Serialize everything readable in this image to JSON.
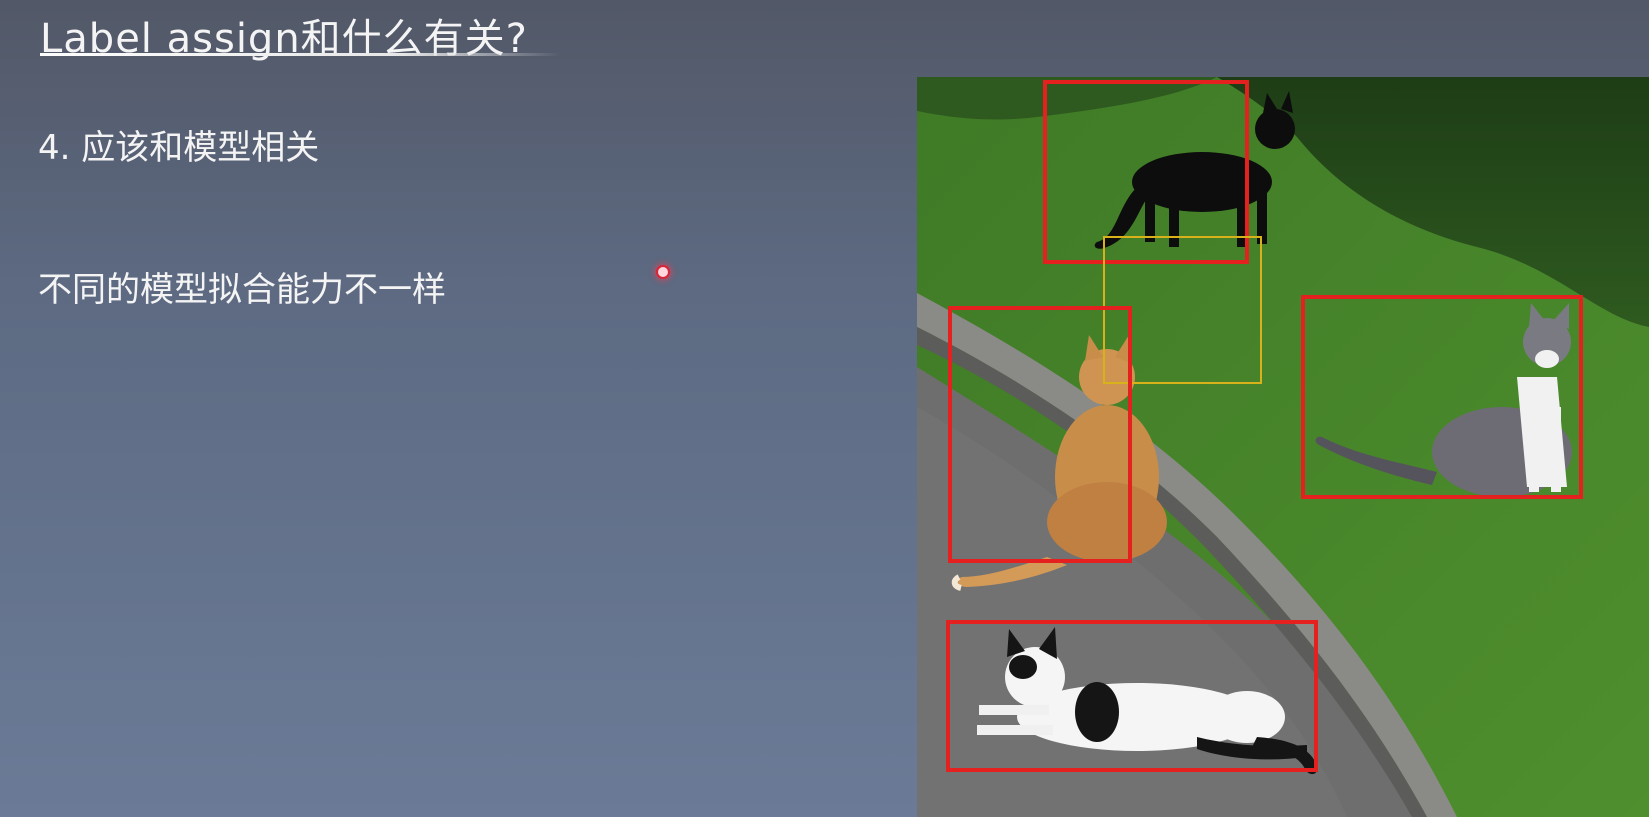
{
  "slide": {
    "title": "Label assign和什么有关?",
    "point": "4. 应该和模型相关",
    "body": "不同的模型拟合能力不一样"
  },
  "photo": {
    "boxes": [
      {
        "name": "black-cat-box",
        "color": "#e5211f"
      },
      {
        "name": "grass-anchor-box",
        "color": "#d8b21a"
      },
      {
        "name": "orange-cat-box",
        "color": "#e5211f"
      },
      {
        "name": "gray-cat-box",
        "color": "#e5211f"
      },
      {
        "name": "white-cat-box",
        "color": "#e5211f"
      }
    ]
  }
}
